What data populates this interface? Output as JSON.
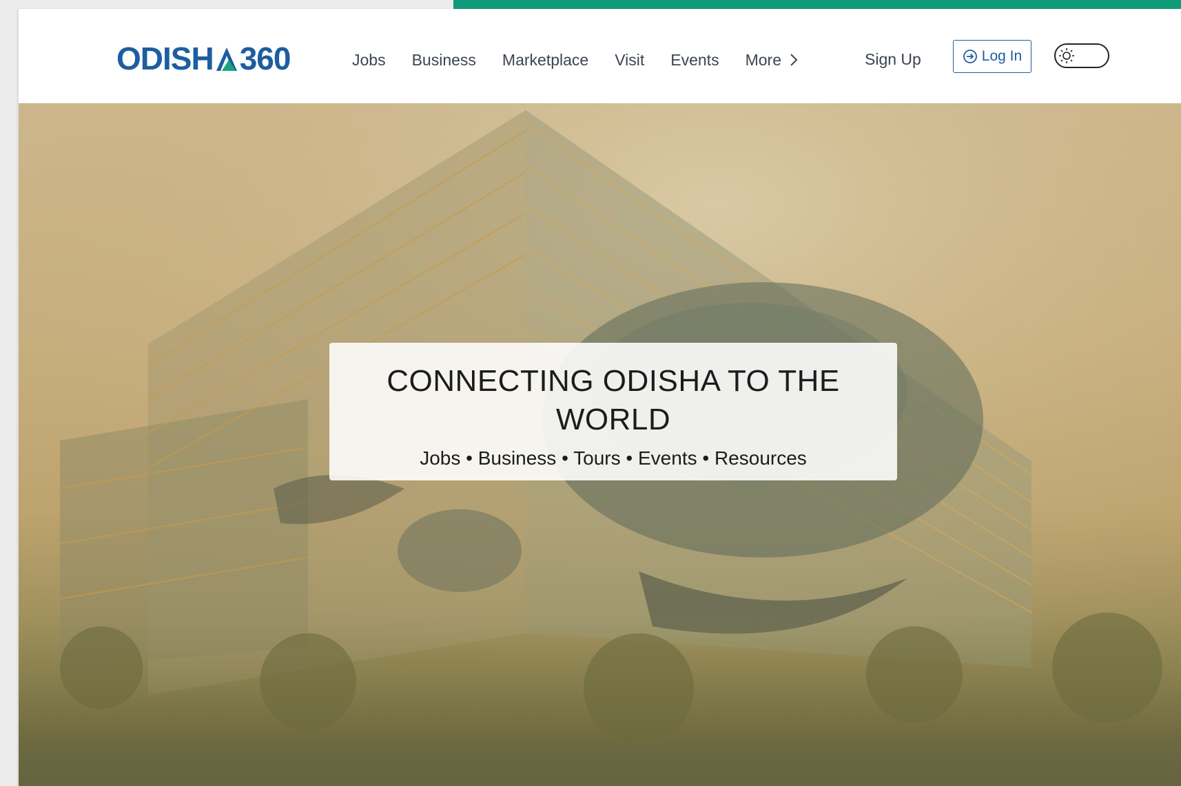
{
  "brand": {
    "logo_text_left": "ODISH",
    "logo_text_right": "360",
    "logo_color": "#1d5da0",
    "logo_accent_color": "#1aa37a"
  },
  "nav": {
    "items": [
      {
        "label": "Jobs"
      },
      {
        "label": "Business"
      },
      {
        "label": "Marketplace"
      },
      {
        "label": "Visit"
      },
      {
        "label": "Events"
      },
      {
        "label": "More",
        "icon": "chevron-right-icon"
      }
    ],
    "signup_label": "Sign Up",
    "login_label": "Log In",
    "login_icon": "login-arrow-icon",
    "theme_toggle_icon": "sun-icon"
  },
  "hero": {
    "title": "CONNECTING ODISHA TO THE WORLD",
    "subtitle": "Jobs • Business • Tours • Events • Resources"
  },
  "colors": {
    "top_accent": "#0f9a7a",
    "text": "#3b4450"
  }
}
